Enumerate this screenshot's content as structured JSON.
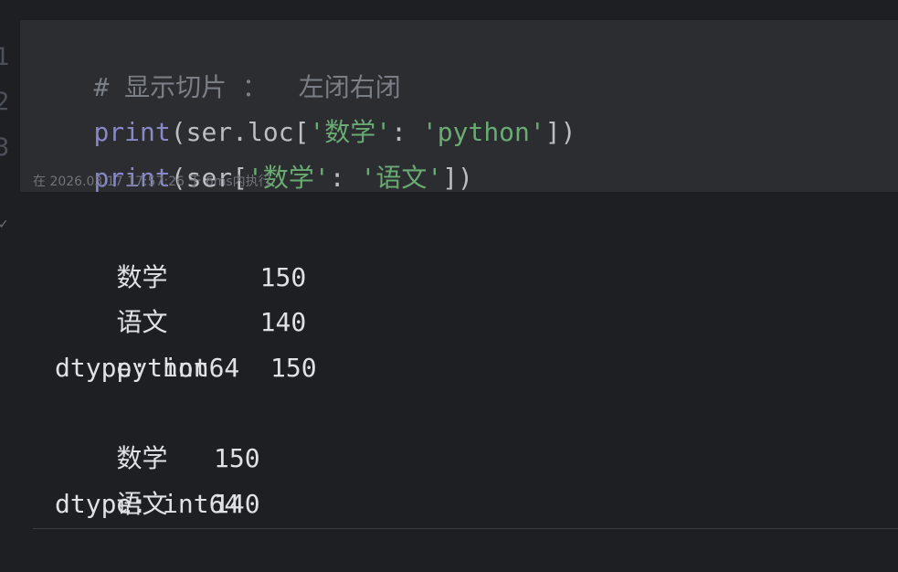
{
  "line_numbers": [
    "1",
    "2",
    "3"
  ],
  "code": {
    "line1": {
      "comment": "# 显示切片 ：  左闭右闭"
    },
    "line2": {
      "builtin": "print",
      "open": "(ser.loc[",
      "str1": "'数学'",
      "sep": ": ",
      "str2": "'python'",
      "close": "])"
    },
    "line3": {
      "builtin": "print",
      "open": "(ser[",
      "str1": "'数学'",
      "sep": ": ",
      "str2": "'语文'",
      "close": "])"
    }
  },
  "exec_info": "在 2026.03.17 17:57:26 于 6ms内执行",
  "output_marker": "✓",
  "output": {
    "series1": [
      {
        "key": "数学",
        "gap": "      ",
        "value": "150"
      },
      {
        "key": "语文",
        "gap": "      ",
        "value": "140"
      },
      {
        "key": "python",
        "gap": "    ",
        "value": "150"
      }
    ],
    "dtype1": "dtype: int64",
    "series2": [
      {
        "key": "数学",
        "gap": "   ",
        "value": "150"
      },
      {
        "key": "语文",
        "gap": "   ",
        "value": "140"
      }
    ],
    "dtype2": "dtype: int64"
  },
  "colors": {
    "background": "#1e1f22",
    "cell_background": "#2b2d30",
    "comment": "#7a7e85",
    "builtin": "#8888c6",
    "string": "#6aab73",
    "text": "#bcbec4",
    "output_text": "#dfe1e5"
  }
}
